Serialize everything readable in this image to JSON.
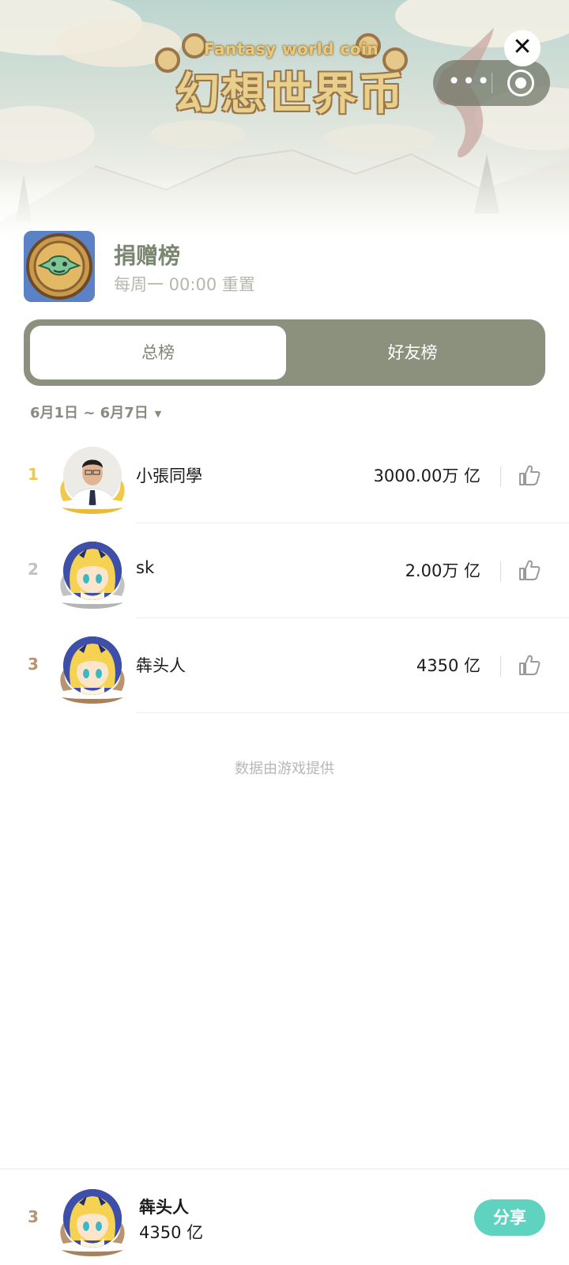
{
  "banner": {
    "logo_subtitle": "Fantasy world coin",
    "logo_title": "幻想世界币"
  },
  "capsule": {
    "more_icon": "more-dots-icon",
    "exit_icon": "target-circle-icon"
  },
  "close_label": "✕",
  "board": {
    "title": "捐赠榜",
    "subtitle": "每周一 00:00 重置"
  },
  "tabs": [
    {
      "label": "总榜",
      "active": true
    },
    {
      "label": "好友榜",
      "active": false
    }
  ],
  "date_range": "6月1日 ~ 6月7日",
  "rank_colors": {
    "1": "#f0c84a",
    "2": "#c2c2c2",
    "3": "#b89470"
  },
  "rows": [
    {
      "rank": "1",
      "name": "小張同學",
      "score": "3000.00万 亿"
    },
    {
      "rank": "2",
      "name": "sk",
      "score": "2.00万 亿"
    },
    {
      "rank": "3",
      "name": "犇头人",
      "score": "4350 亿"
    }
  ],
  "footnote": "数据由游戏提供",
  "me": {
    "rank": "3",
    "name": "犇头人",
    "score": "4350 亿",
    "share_label": "分享"
  }
}
